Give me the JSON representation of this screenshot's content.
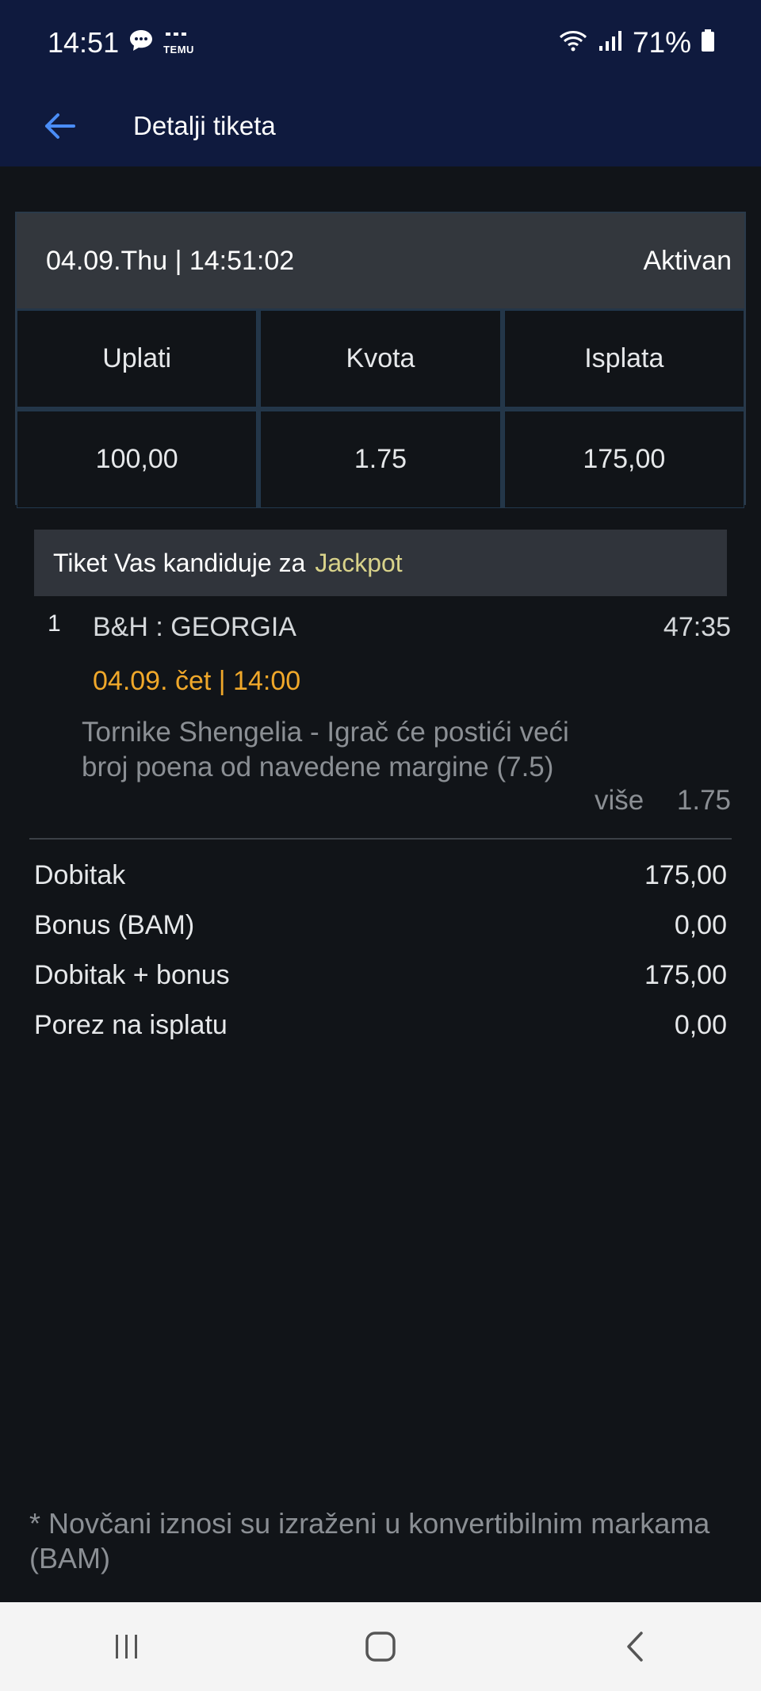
{
  "status_bar": {
    "time": "14:51",
    "temu_text": "TEMU",
    "battery_percent": "71%",
    "icons": [
      "chat-bubble-icon",
      "temu-icon",
      "wifi-icon",
      "signal-icon",
      "battery-icon"
    ]
  },
  "header": {
    "title": "Detalji tiketa",
    "back_icon": "arrow-left-icon",
    "color": "#0f1a3e"
  },
  "ticket": {
    "datetime": "04.09.Thu | 14:51:02",
    "status": "Aktivan",
    "columns": [
      "Uplati",
      "Kvota",
      "Isplata"
    ],
    "values": [
      "100,00",
      "1.75",
      "175,00"
    ]
  },
  "jackpot": {
    "text": "Tiket Vas kandiduje za",
    "highlight": "Jackpot",
    "highlight_color": "#d8d28a"
  },
  "event": {
    "number": "1",
    "teams": "B&H : GEORGIA",
    "clock": "47:35",
    "date": "04.09. čet | 14:00",
    "date_color": "#f0a82a",
    "description": "Tornike Shengelia - Igrač će postići veći broj poena od navedene margine (7.5)",
    "pick": "više",
    "odd": "1.75"
  },
  "summary": [
    {
      "label": "Dobitak",
      "value": "175,00"
    },
    {
      "label": "Bonus (BAM)",
      "value": "0,00"
    },
    {
      "label": "Dobitak + bonus",
      "value": "175,00"
    },
    {
      "label": "Porez na isplatu",
      "value": "0,00"
    }
  ],
  "footnote": "* Novčani iznosi su izraženi u konvertibilnim markama (BAM)",
  "nav_bar": {
    "icons": [
      "recent-apps-icon",
      "home-icon",
      "back-icon"
    ]
  }
}
